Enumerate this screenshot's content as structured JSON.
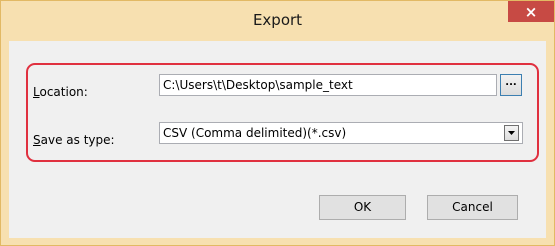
{
  "window": {
    "title": "Export",
    "close_label": "×"
  },
  "form": {
    "location_label": {
      "underlined": "L",
      "rest": "ocation:"
    },
    "location_value": "C:\\Users\\t\\Desktop\\sample_text",
    "browse_label": "...",
    "save_as_type_label": {
      "underlined": "S",
      "rest": "ave as type:"
    },
    "save_as_type_value": "CSV (Comma delimited)(*.csv)"
  },
  "buttons": {
    "ok": "OK",
    "cancel": "Cancel"
  },
  "icons": {
    "close": "close-icon",
    "dropdown": "chevron-down-icon"
  },
  "colors": {
    "frame": "#f7e0b0",
    "close_button": "#c74a44",
    "highlight": "#e0303f"
  }
}
